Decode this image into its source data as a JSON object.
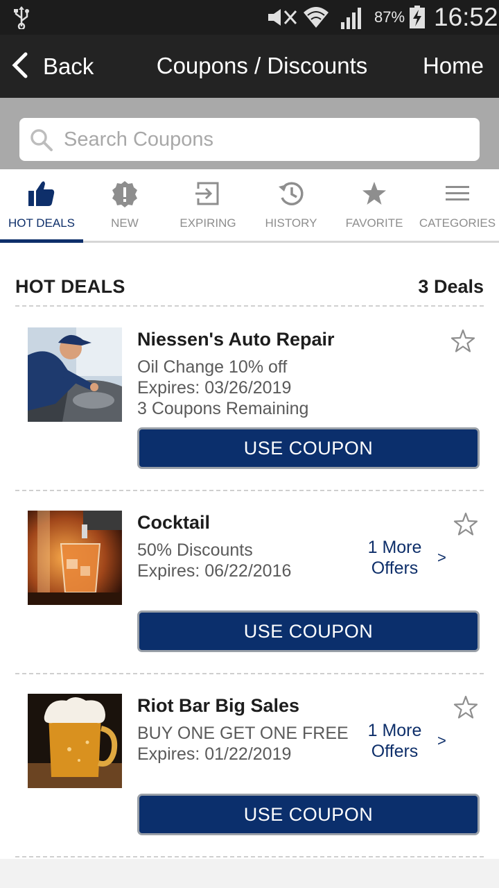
{
  "status_bar": {
    "battery": "87%",
    "time": "16:52"
  },
  "nav": {
    "back_label": "Back",
    "title": "Coupons / Discounts",
    "home_label": "Home"
  },
  "search": {
    "placeholder": "Search Coupons",
    "value": ""
  },
  "tabs": [
    {
      "label": "HOT DEALS",
      "icon": "thumbs-up-icon",
      "active": true
    },
    {
      "label": "NEW",
      "icon": "alert-badge-icon"
    },
    {
      "label": "EXPIRING",
      "icon": "exit-icon"
    },
    {
      "label": "HISTORY",
      "icon": "history-icon"
    },
    {
      "label": "FAVORITE",
      "icon": "star-icon"
    },
    {
      "label": "CATEGORIES",
      "icon": "menu-icon"
    }
  ],
  "list": {
    "title": "HOT DEALS",
    "count": "3 Deals"
  },
  "deals": [
    {
      "name": "Niessen's Auto Repair",
      "description": "Oil Change 10% off",
      "expires": "Expires: 03/26/2019",
      "remaining": "3 Coupons Remaining",
      "button": "USE COUPON"
    },
    {
      "name": "Cocktail",
      "description": "50% Discounts",
      "expires": "Expires: 06/22/2016",
      "more_offers": "1 More Offers",
      "more_chevron": ">",
      "button": "USE COUPON"
    },
    {
      "name": "Riot Bar Big Sales",
      "description": "BUY ONE GET ONE FREE",
      "expires": "Expires: 01/22/2019",
      "more_offers": "1 More Offers",
      "more_chevron": ">",
      "button": "USE COUPON"
    }
  ],
  "colors": {
    "accent": "#0b2f6c",
    "nav_bg": "#232323",
    "status_bg": "#1c1c1c",
    "search_bg": "#a9a9a9"
  }
}
